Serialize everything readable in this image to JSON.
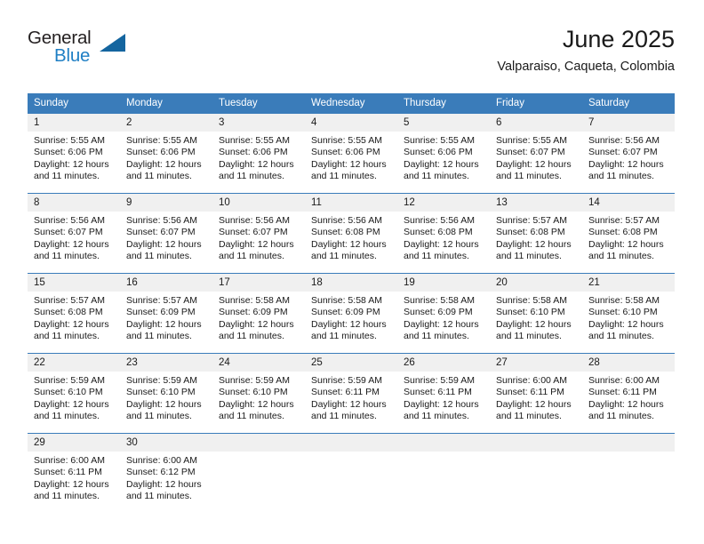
{
  "brand": {
    "name_part1": "General",
    "name_part2": "Blue",
    "accent_color": "#1f7fc4",
    "triangle_color": "#14659f",
    "logo_icon": "triangle-flag-icon"
  },
  "header": {
    "title": "June 2025",
    "subtitle": "Valparaiso, Caqueta, Colombia"
  },
  "theme": {
    "header_bg": "#3a7cba",
    "header_text": "#ffffff",
    "daynum_bg": "#f0f0f0",
    "cell_bg": "#ffffff",
    "grid_line": "#3a7cba"
  },
  "weekdays": [
    "Sunday",
    "Monday",
    "Tuesday",
    "Wednesday",
    "Thursday",
    "Friday",
    "Saturday"
  ],
  "weeks": [
    [
      {
        "day": "1",
        "sunrise": "Sunrise: 5:55 AM",
        "sunset": "Sunset: 6:06 PM",
        "daylight": "Daylight: 12 hours and 11 minutes."
      },
      {
        "day": "2",
        "sunrise": "Sunrise: 5:55 AM",
        "sunset": "Sunset: 6:06 PM",
        "daylight": "Daylight: 12 hours and 11 minutes."
      },
      {
        "day": "3",
        "sunrise": "Sunrise: 5:55 AM",
        "sunset": "Sunset: 6:06 PM",
        "daylight": "Daylight: 12 hours and 11 minutes."
      },
      {
        "day": "4",
        "sunrise": "Sunrise: 5:55 AM",
        "sunset": "Sunset: 6:06 PM",
        "daylight": "Daylight: 12 hours and 11 minutes."
      },
      {
        "day": "5",
        "sunrise": "Sunrise: 5:55 AM",
        "sunset": "Sunset: 6:06 PM",
        "daylight": "Daylight: 12 hours and 11 minutes."
      },
      {
        "day": "6",
        "sunrise": "Sunrise: 5:55 AM",
        "sunset": "Sunset: 6:07 PM",
        "daylight": "Daylight: 12 hours and 11 minutes."
      },
      {
        "day": "7",
        "sunrise": "Sunrise: 5:56 AM",
        "sunset": "Sunset: 6:07 PM",
        "daylight": "Daylight: 12 hours and 11 minutes."
      }
    ],
    [
      {
        "day": "8",
        "sunrise": "Sunrise: 5:56 AM",
        "sunset": "Sunset: 6:07 PM",
        "daylight": "Daylight: 12 hours and 11 minutes."
      },
      {
        "day": "9",
        "sunrise": "Sunrise: 5:56 AM",
        "sunset": "Sunset: 6:07 PM",
        "daylight": "Daylight: 12 hours and 11 minutes."
      },
      {
        "day": "10",
        "sunrise": "Sunrise: 5:56 AM",
        "sunset": "Sunset: 6:07 PM",
        "daylight": "Daylight: 12 hours and 11 minutes."
      },
      {
        "day": "11",
        "sunrise": "Sunrise: 5:56 AM",
        "sunset": "Sunset: 6:08 PM",
        "daylight": "Daylight: 12 hours and 11 minutes."
      },
      {
        "day": "12",
        "sunrise": "Sunrise: 5:56 AM",
        "sunset": "Sunset: 6:08 PM",
        "daylight": "Daylight: 12 hours and 11 minutes."
      },
      {
        "day": "13",
        "sunrise": "Sunrise: 5:57 AM",
        "sunset": "Sunset: 6:08 PM",
        "daylight": "Daylight: 12 hours and 11 minutes."
      },
      {
        "day": "14",
        "sunrise": "Sunrise: 5:57 AM",
        "sunset": "Sunset: 6:08 PM",
        "daylight": "Daylight: 12 hours and 11 minutes."
      }
    ],
    [
      {
        "day": "15",
        "sunrise": "Sunrise: 5:57 AM",
        "sunset": "Sunset: 6:08 PM",
        "daylight": "Daylight: 12 hours and 11 minutes."
      },
      {
        "day": "16",
        "sunrise": "Sunrise: 5:57 AM",
        "sunset": "Sunset: 6:09 PM",
        "daylight": "Daylight: 12 hours and 11 minutes."
      },
      {
        "day": "17",
        "sunrise": "Sunrise: 5:58 AM",
        "sunset": "Sunset: 6:09 PM",
        "daylight": "Daylight: 12 hours and 11 minutes."
      },
      {
        "day": "18",
        "sunrise": "Sunrise: 5:58 AM",
        "sunset": "Sunset: 6:09 PM",
        "daylight": "Daylight: 12 hours and 11 minutes."
      },
      {
        "day": "19",
        "sunrise": "Sunrise: 5:58 AM",
        "sunset": "Sunset: 6:09 PM",
        "daylight": "Daylight: 12 hours and 11 minutes."
      },
      {
        "day": "20",
        "sunrise": "Sunrise: 5:58 AM",
        "sunset": "Sunset: 6:10 PM",
        "daylight": "Daylight: 12 hours and 11 minutes."
      },
      {
        "day": "21",
        "sunrise": "Sunrise: 5:58 AM",
        "sunset": "Sunset: 6:10 PM",
        "daylight": "Daylight: 12 hours and 11 minutes."
      }
    ],
    [
      {
        "day": "22",
        "sunrise": "Sunrise: 5:59 AM",
        "sunset": "Sunset: 6:10 PM",
        "daylight": "Daylight: 12 hours and 11 minutes."
      },
      {
        "day": "23",
        "sunrise": "Sunrise: 5:59 AM",
        "sunset": "Sunset: 6:10 PM",
        "daylight": "Daylight: 12 hours and 11 minutes."
      },
      {
        "day": "24",
        "sunrise": "Sunrise: 5:59 AM",
        "sunset": "Sunset: 6:10 PM",
        "daylight": "Daylight: 12 hours and 11 minutes."
      },
      {
        "day": "25",
        "sunrise": "Sunrise: 5:59 AM",
        "sunset": "Sunset: 6:11 PM",
        "daylight": "Daylight: 12 hours and 11 minutes."
      },
      {
        "day": "26",
        "sunrise": "Sunrise: 5:59 AM",
        "sunset": "Sunset: 6:11 PM",
        "daylight": "Daylight: 12 hours and 11 minutes."
      },
      {
        "day": "27",
        "sunrise": "Sunrise: 6:00 AM",
        "sunset": "Sunset: 6:11 PM",
        "daylight": "Daylight: 12 hours and 11 minutes."
      },
      {
        "day": "28",
        "sunrise": "Sunrise: 6:00 AM",
        "sunset": "Sunset: 6:11 PM",
        "daylight": "Daylight: 12 hours and 11 minutes."
      }
    ],
    [
      {
        "day": "29",
        "sunrise": "Sunrise: 6:00 AM",
        "sunset": "Sunset: 6:11 PM",
        "daylight": "Daylight: 12 hours and 11 minutes."
      },
      {
        "day": "30",
        "sunrise": "Sunrise: 6:00 AM",
        "sunset": "Sunset: 6:12 PM",
        "daylight": "Daylight: 12 hours and 11 minutes."
      },
      {
        "day": "",
        "sunrise": "",
        "sunset": "",
        "daylight": ""
      },
      {
        "day": "",
        "sunrise": "",
        "sunset": "",
        "daylight": ""
      },
      {
        "day": "",
        "sunrise": "",
        "sunset": "",
        "daylight": ""
      },
      {
        "day": "",
        "sunrise": "",
        "sunset": "",
        "daylight": ""
      },
      {
        "day": "",
        "sunrise": "",
        "sunset": "",
        "daylight": ""
      }
    ]
  ]
}
